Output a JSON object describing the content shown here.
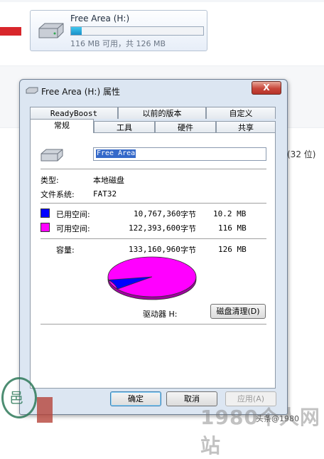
{
  "explorer": {
    "drive_title": "Free Area (H:)",
    "drive_subtitle": "116 MB 可用，共 126 MB",
    "used_fraction": 0.08,
    "side_text": "(32 位)"
  },
  "dialog": {
    "title": "Free Area (H:) 属性",
    "close_label": "X",
    "tabs_row1": [
      "ReadyBoost",
      "以前的版本",
      "自定义"
    ],
    "tabs_row2": [
      "常规",
      "工具",
      "硬件",
      "共享"
    ],
    "active_tab": "常规",
    "volume_name": "Free Area",
    "type_label": "类型:",
    "type_value": "本地磁盘",
    "fs_label": "文件系统:",
    "fs_value": "FAT32",
    "used_label": "已用空间:",
    "used_bytes": "10,767,360",
    "used_unit": "字节",
    "used_size": "10.2 MB",
    "free_label": "可用空间:",
    "free_bytes": "122,393,600",
    "free_unit": "字节",
    "free_size": "116 MB",
    "capacity_label": "容量:",
    "capacity_bytes": "133,160,960",
    "capacity_unit": "字节",
    "capacity_size": "126 MB",
    "drive_label": "驱动器 H:",
    "cleanup_button": "磁盘清理(D)",
    "ok_button": "确定",
    "cancel_button": "取消",
    "apply_button": "应用(A)",
    "colors": {
      "used": "#0000ff",
      "free": "#ff00ff"
    },
    "used_ratio": 0.081
  },
  "watermark": {
    "text": "1980个人网站",
    "small_text": "头条@1980"
  }
}
